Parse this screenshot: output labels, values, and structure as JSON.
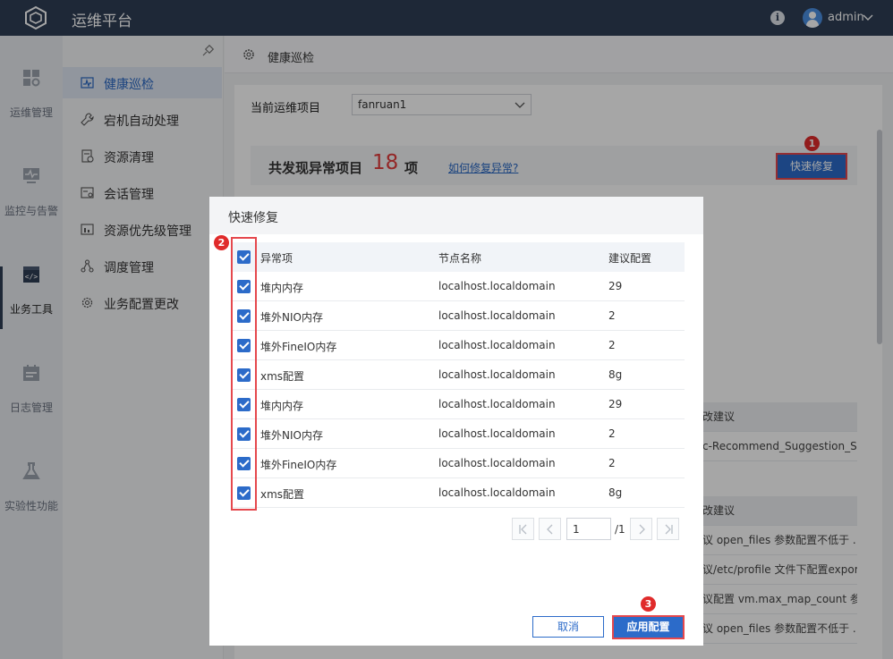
{
  "app": {
    "title": "运维平台",
    "user": "admin"
  },
  "rail": [
    {
      "label": "运维管理",
      "icon": "dashboard-icon"
    },
    {
      "label": "监控与告警",
      "icon": "monitor-icon"
    },
    {
      "label": "业务工具",
      "icon": "code-window-icon",
      "active": true
    },
    {
      "label": "日志管理",
      "icon": "calendar-icon"
    },
    {
      "label": "实验性功能",
      "icon": "flask-icon"
    }
  ],
  "menu": [
    {
      "label": "健康巡检",
      "icon": "health-check-icon",
      "active": true
    },
    {
      "label": "宕机自动处理",
      "icon": "wrench-icon"
    },
    {
      "label": "资源清理",
      "icon": "clean-icon"
    },
    {
      "label": "会话管理",
      "icon": "session-icon"
    },
    {
      "label": "资源优先级管理",
      "icon": "priority-icon"
    },
    {
      "label": "调度管理",
      "icon": "schedule-icon"
    },
    {
      "label": "业务配置更改",
      "icon": "config-icon"
    }
  ],
  "breadcrumb": "健康巡检",
  "project": {
    "label": "当前运维项目",
    "value": "fanruan1"
  },
  "summary": {
    "prefix": "共发现异常项目",
    "count": "18",
    "unit": "项",
    "link": "如何修复异常?",
    "quick_fix": "快速修复"
  },
  "background_panel": {
    "header1": "改建议",
    "row1": "c-Recommend_Suggestion_S...",
    "header2": "改建议",
    "rows": [
      "议 open_files 参数配置不低于 ...",
      "议/etc/profile 文件下配置expor...",
      "议配置 vm.max_map_count 参...",
      "议 open_files 参数配置不低于 ..."
    ]
  },
  "dialog": {
    "title": "快速修复",
    "columns": [
      "异常项",
      "节点名称",
      "建议配置"
    ],
    "rows": [
      {
        "item": "堆内内存",
        "node": "localhost.localdomain",
        "suggested": "29"
      },
      {
        "item": "堆外NIO内存",
        "node": "localhost.localdomain",
        "suggested": "2"
      },
      {
        "item": "堆外FineIO内存",
        "node": "localhost.localdomain",
        "suggested": "2"
      },
      {
        "item": "xms配置",
        "node": "localhost.localdomain",
        "suggested": "8g"
      },
      {
        "item": "堆内内存",
        "node": "localhost.localdomain",
        "suggested": "29"
      },
      {
        "item": "堆外NIO内存",
        "node": "localhost.localdomain",
        "suggested": "2"
      },
      {
        "item": "堆外FineIO内存",
        "node": "localhost.localdomain",
        "suggested": "2"
      },
      {
        "item": "xms配置",
        "node": "localhost.localdomain",
        "suggested": "8g"
      }
    ],
    "pager": {
      "page": "1",
      "total": "/1"
    },
    "cancel": "取消",
    "apply": "应用配置"
  },
  "markers": [
    "1",
    "2",
    "3"
  ],
  "colors": {
    "topbar": "#2f3e55",
    "primary": "#2c6bc9",
    "highlight": "#e5484d",
    "danger_count": "#e23b3b"
  }
}
